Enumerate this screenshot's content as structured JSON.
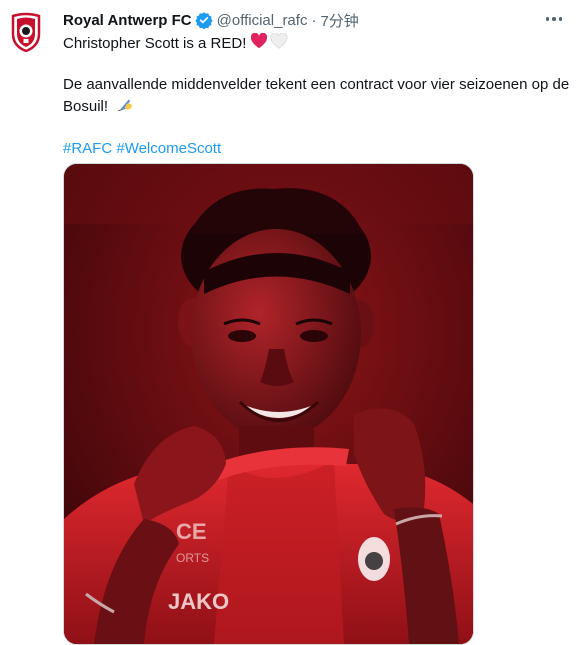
{
  "account": {
    "name": "Royal Antwerp FC",
    "handle": "@official_rafc",
    "separator": "·",
    "time": "7分钟"
  },
  "tweet": {
    "line1": "Christopher Scott is a RED!",
    "line2": "De aanvallende middenvelder tekent een contract voor vier seizoenen op de",
    "line3": "Bosuil!",
    "hashtags": [
      "#RAFC",
      "#WelcomeScott"
    ]
  },
  "photo": {
    "shirt_sponsor": "JAKO",
    "shirt_print_1": "CE",
    "shirt_print_2": "ORTS"
  },
  "colors": {
    "hashtag": "#1d9bf0",
    "secondary_text": "#536471",
    "verified": "#1d9bf0",
    "heart_red": "#e0245e",
    "photo_red": "#b5121b"
  },
  "icons": {
    "avatar": "royal-antwerp-crest-icon",
    "verified": "verified-badge-icon",
    "more": "more-options-icon",
    "emoji1": "red-heart-icon",
    "emoji2": "white-heart-icon",
    "emoji3": "writing-hand-icon"
  }
}
